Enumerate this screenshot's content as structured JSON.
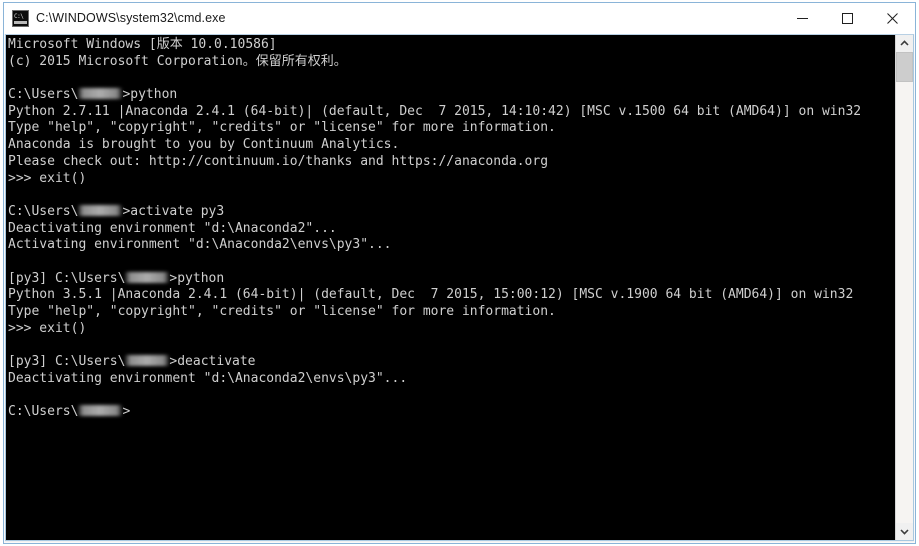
{
  "window": {
    "title": "C:\\WINDOWS\\system32\\cmd.exe",
    "icon": "cmd-console-icon",
    "controls": {
      "minimize": "minimize-icon",
      "maximize": "maximize-icon",
      "close": "close-icon"
    },
    "colors": {
      "titlebar_bg": "#ffffff",
      "title_fg": "#1a1a1a",
      "console_bg": "#000000",
      "console_fg": "#cfcfcf",
      "border": "#8ab4d8",
      "scrollbar_track": "#f6f4f2",
      "scrollbar_thumb": "#cdcdcd"
    }
  },
  "scrollbar": {
    "up_arrow": "chevron-up-icon",
    "down_arrow": "chevron-down-icon",
    "thumb_label": "scrollbar-thumb"
  },
  "console": {
    "prompt_user_redacted": true,
    "lines": [
      "Microsoft Windows [版本 10.0.10586]",
      "(c) 2015 Microsoft Corporation。保留所有权利。",
      "",
      "C:\\Users\\\u0000>python",
      "Python 2.7.11 |Anaconda 2.4.1 (64-bit)| (default, Dec  7 2015, 14:10:42) [MSC v.1500 64 bit (AMD64)] on win32",
      "Type \"help\", \"copyright\", \"credits\" or \"license\" for more information.",
      "Anaconda is brought to you by Continuum Analytics.",
      "Please check out: http://continuum.io/thanks and https://anaconda.org",
      ">>> exit()",
      "",
      "C:\\Users\\\u0000>activate py3",
      "Deactivating environment \"d:\\Anaconda2\"...",
      "Activating environment \"d:\\Anaconda2\\envs\\py3\"...",
      "",
      "[py3] C:\\Users\\\u0000>python",
      "Python 3.5.1 |Anaconda 2.4.1 (64-bit)| (default, Dec  7 2015, 15:00:12) [MSC v.1900 64 bit (AMD64)] on win32",
      "Type \"help\", \"copyright\", \"credits\" or \"license\" for more information.",
      ">>> exit()",
      "",
      "[py3] C:\\Users\\\u0000>deactivate",
      "Deactivating environment \"d:\\Anaconda2\\envs\\py3\"...",
      "",
      "C:\\Users\\\u0000>"
    ]
  }
}
